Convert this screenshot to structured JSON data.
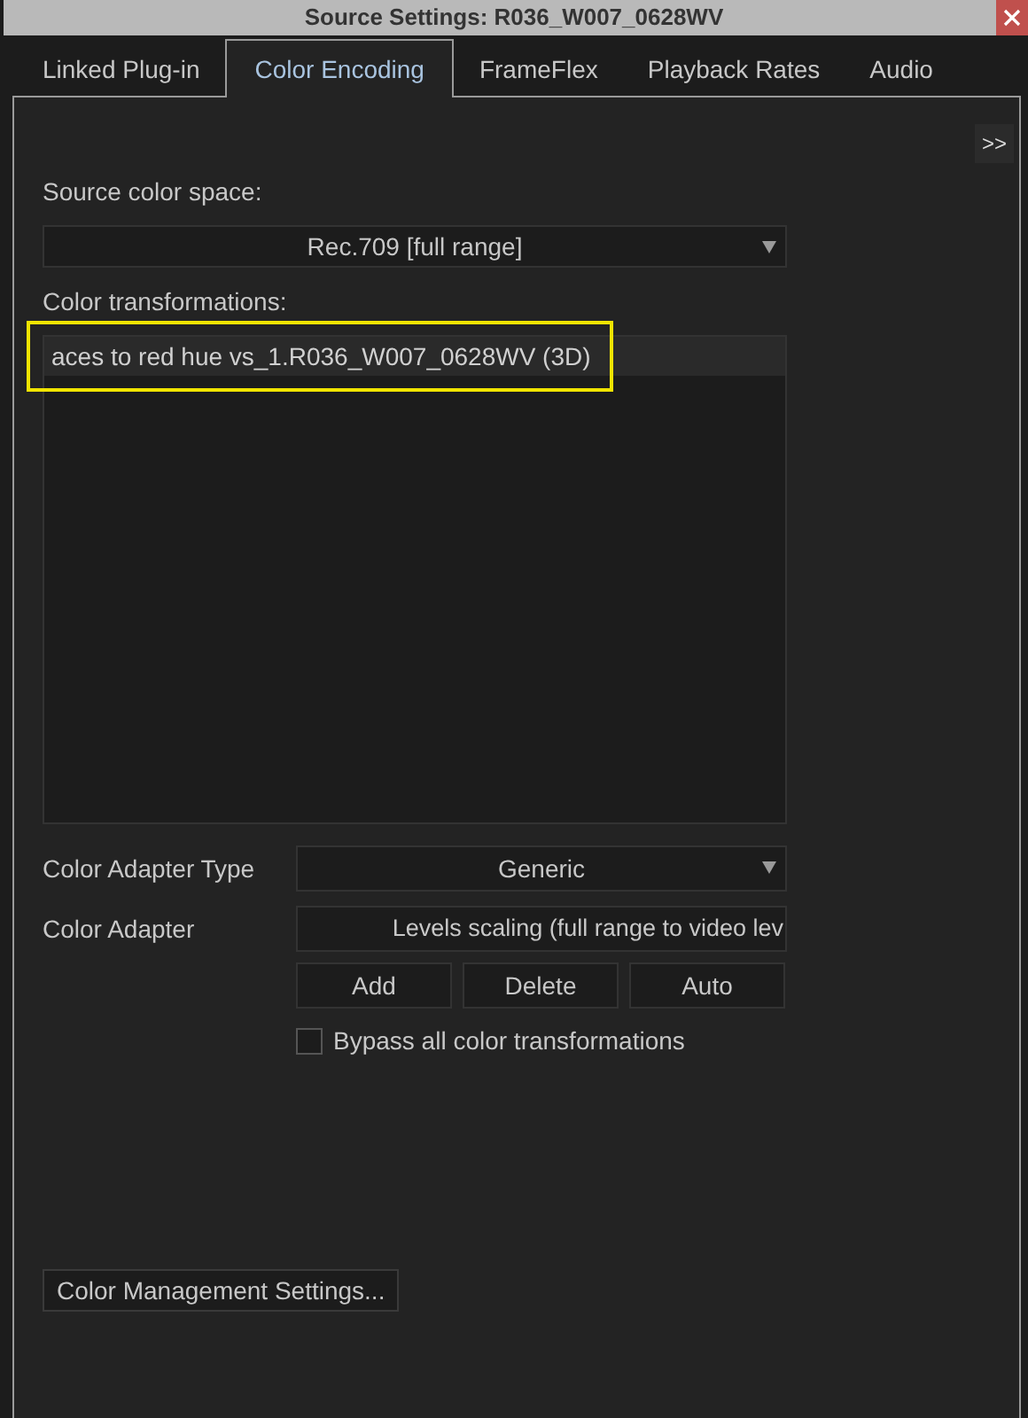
{
  "window": {
    "title": "Source Settings: R036_W007_0628WV"
  },
  "tabs": [
    {
      "label": "Linked Plug-in",
      "selected": false
    },
    {
      "label": "Color Encoding",
      "selected": true
    },
    {
      "label": "FrameFlex",
      "selected": false
    },
    {
      "label": "Playback Rates",
      "selected": false
    },
    {
      "label": "Audio",
      "selected": false
    }
  ],
  "expand_button": ">>",
  "source_color_space": {
    "label": "Source color space:",
    "value": "Rec.709 [full range]"
  },
  "color_transformations": {
    "label": "Color transformations:",
    "items": [
      {
        "text": "aces to red hue vs_1.R036_W007_0628WV (3D)",
        "selected": true,
        "highlighted": true
      }
    ]
  },
  "color_adapter_type": {
    "label": "Color Adapter Type",
    "value": "Generic"
  },
  "color_adapter": {
    "label": "Color Adapter",
    "value": "Levels scaling (full range to video lev"
  },
  "buttons": [
    "Add",
    "Delete",
    "Auto"
  ],
  "bypass": {
    "label": "Bypass all color transformations",
    "checked": false
  },
  "footer_button": "Color Management Settings..."
}
